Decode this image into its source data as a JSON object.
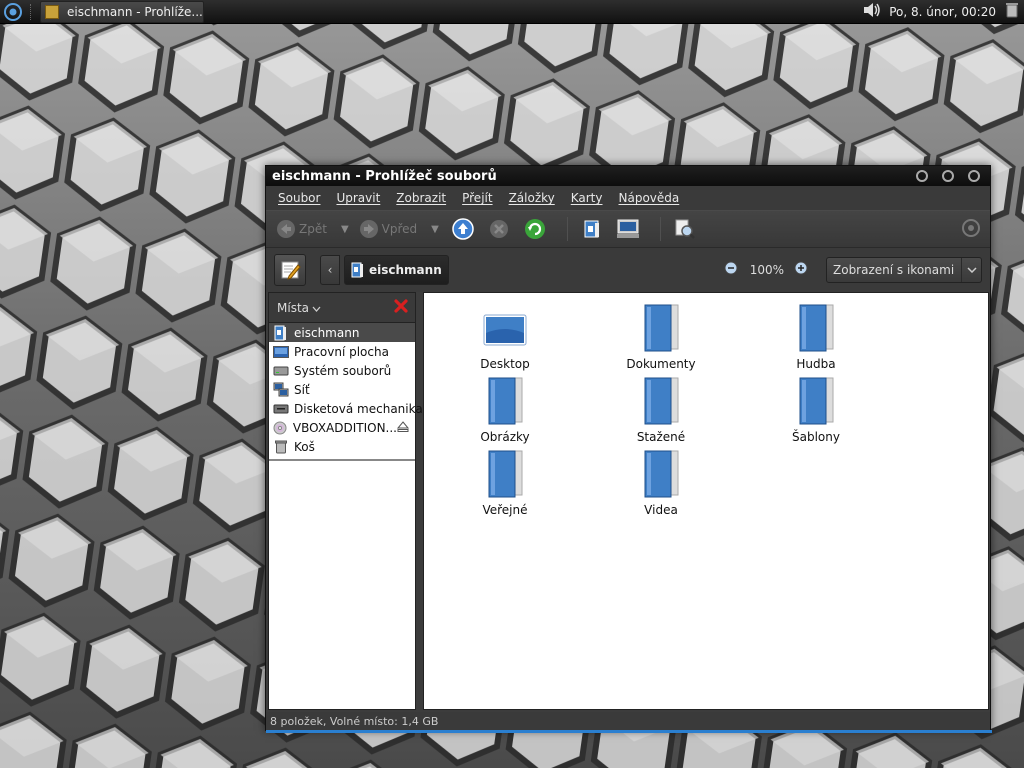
{
  "panel": {
    "task_title": "eischmann - Prohlíže...",
    "clock": "Po,  8. únor, 00:20"
  },
  "window": {
    "title": "eischmann - Prohlížeč souborů"
  },
  "menubar": {
    "items": [
      "Soubor",
      "Upravit",
      "Zobrazit",
      "Přejít",
      "Záložky",
      "Karty",
      "Nápověda"
    ]
  },
  "toolbar": {
    "back_label": "Zpět",
    "forward_label": "Vpřed"
  },
  "location": {
    "current_folder": "eischmann",
    "zoom": "100%",
    "view_mode": "Zobrazení s ikonami"
  },
  "sidebar": {
    "header": "Místa",
    "places": [
      {
        "label": "eischmann",
        "icon": "home-folder-icon",
        "selected": true
      },
      {
        "label": "Pracovní plocha",
        "icon": "desktop-icon"
      },
      {
        "label": "Systém souborů",
        "icon": "harddisk-icon"
      },
      {
        "label": "Síť",
        "icon": "network-icon"
      },
      {
        "label": "Disketová mechanika",
        "icon": "floppy-drive-icon"
      },
      {
        "label": "VBOXADDITION...",
        "icon": "cdrom-icon",
        "eject": true
      },
      {
        "label": "Koš",
        "icon": "trash-icon"
      }
    ]
  },
  "files": [
    {
      "name": "Desktop",
      "icon": "desktop-folder-icon"
    },
    {
      "name": "Dokumenty",
      "icon": "folder-icon"
    },
    {
      "name": "Hudba",
      "icon": "folder-icon"
    },
    {
      "name": "Obrázky",
      "icon": "folder-icon"
    },
    {
      "name": "Stažené",
      "icon": "folder-icon"
    },
    {
      "name": "Šablony",
      "icon": "folder-icon"
    },
    {
      "name": "Veřejné",
      "icon": "folder-icon"
    },
    {
      "name": "Videa",
      "icon": "folder-icon"
    }
  ],
  "status": {
    "text": "8 položek, Volné místo: 1,4 GB"
  },
  "colors": {
    "accent": "#2a7fd0",
    "folder_blue": "#3f7fc6",
    "close_red": "#d82020"
  }
}
